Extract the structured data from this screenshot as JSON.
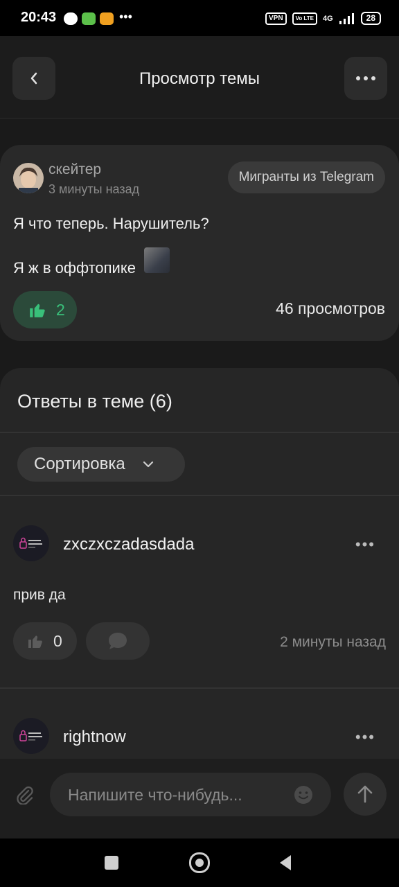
{
  "status_bar": {
    "time": "20:43",
    "vpn": "VPN",
    "volte": "Vo LTE",
    "network": "4G",
    "battery": "28"
  },
  "header": {
    "title": "Просмотр темы"
  },
  "post": {
    "author": "скейтер",
    "time": "3 минуты назад",
    "tag": "Мигранты из Telegram",
    "text_line1": "Я что теперь. Нарушитель?",
    "text_line2": "Я ж в оффтопике",
    "likes": "2",
    "views": "46 просмотров"
  },
  "answers": {
    "title": "Ответы в теме (6)",
    "sort_label": "Сортировка",
    "comments": [
      {
        "author": "zxczxczadasdada",
        "text": "прив да",
        "likes": "0",
        "time": "2 минуты назад"
      },
      {
        "author": "rightnow"
      }
    ]
  },
  "input": {
    "placeholder": "Напишите что-нибудь..."
  },
  "colors": {
    "background": "#1a1a1a",
    "card": "#292929",
    "accent_green": "#39c07a"
  }
}
